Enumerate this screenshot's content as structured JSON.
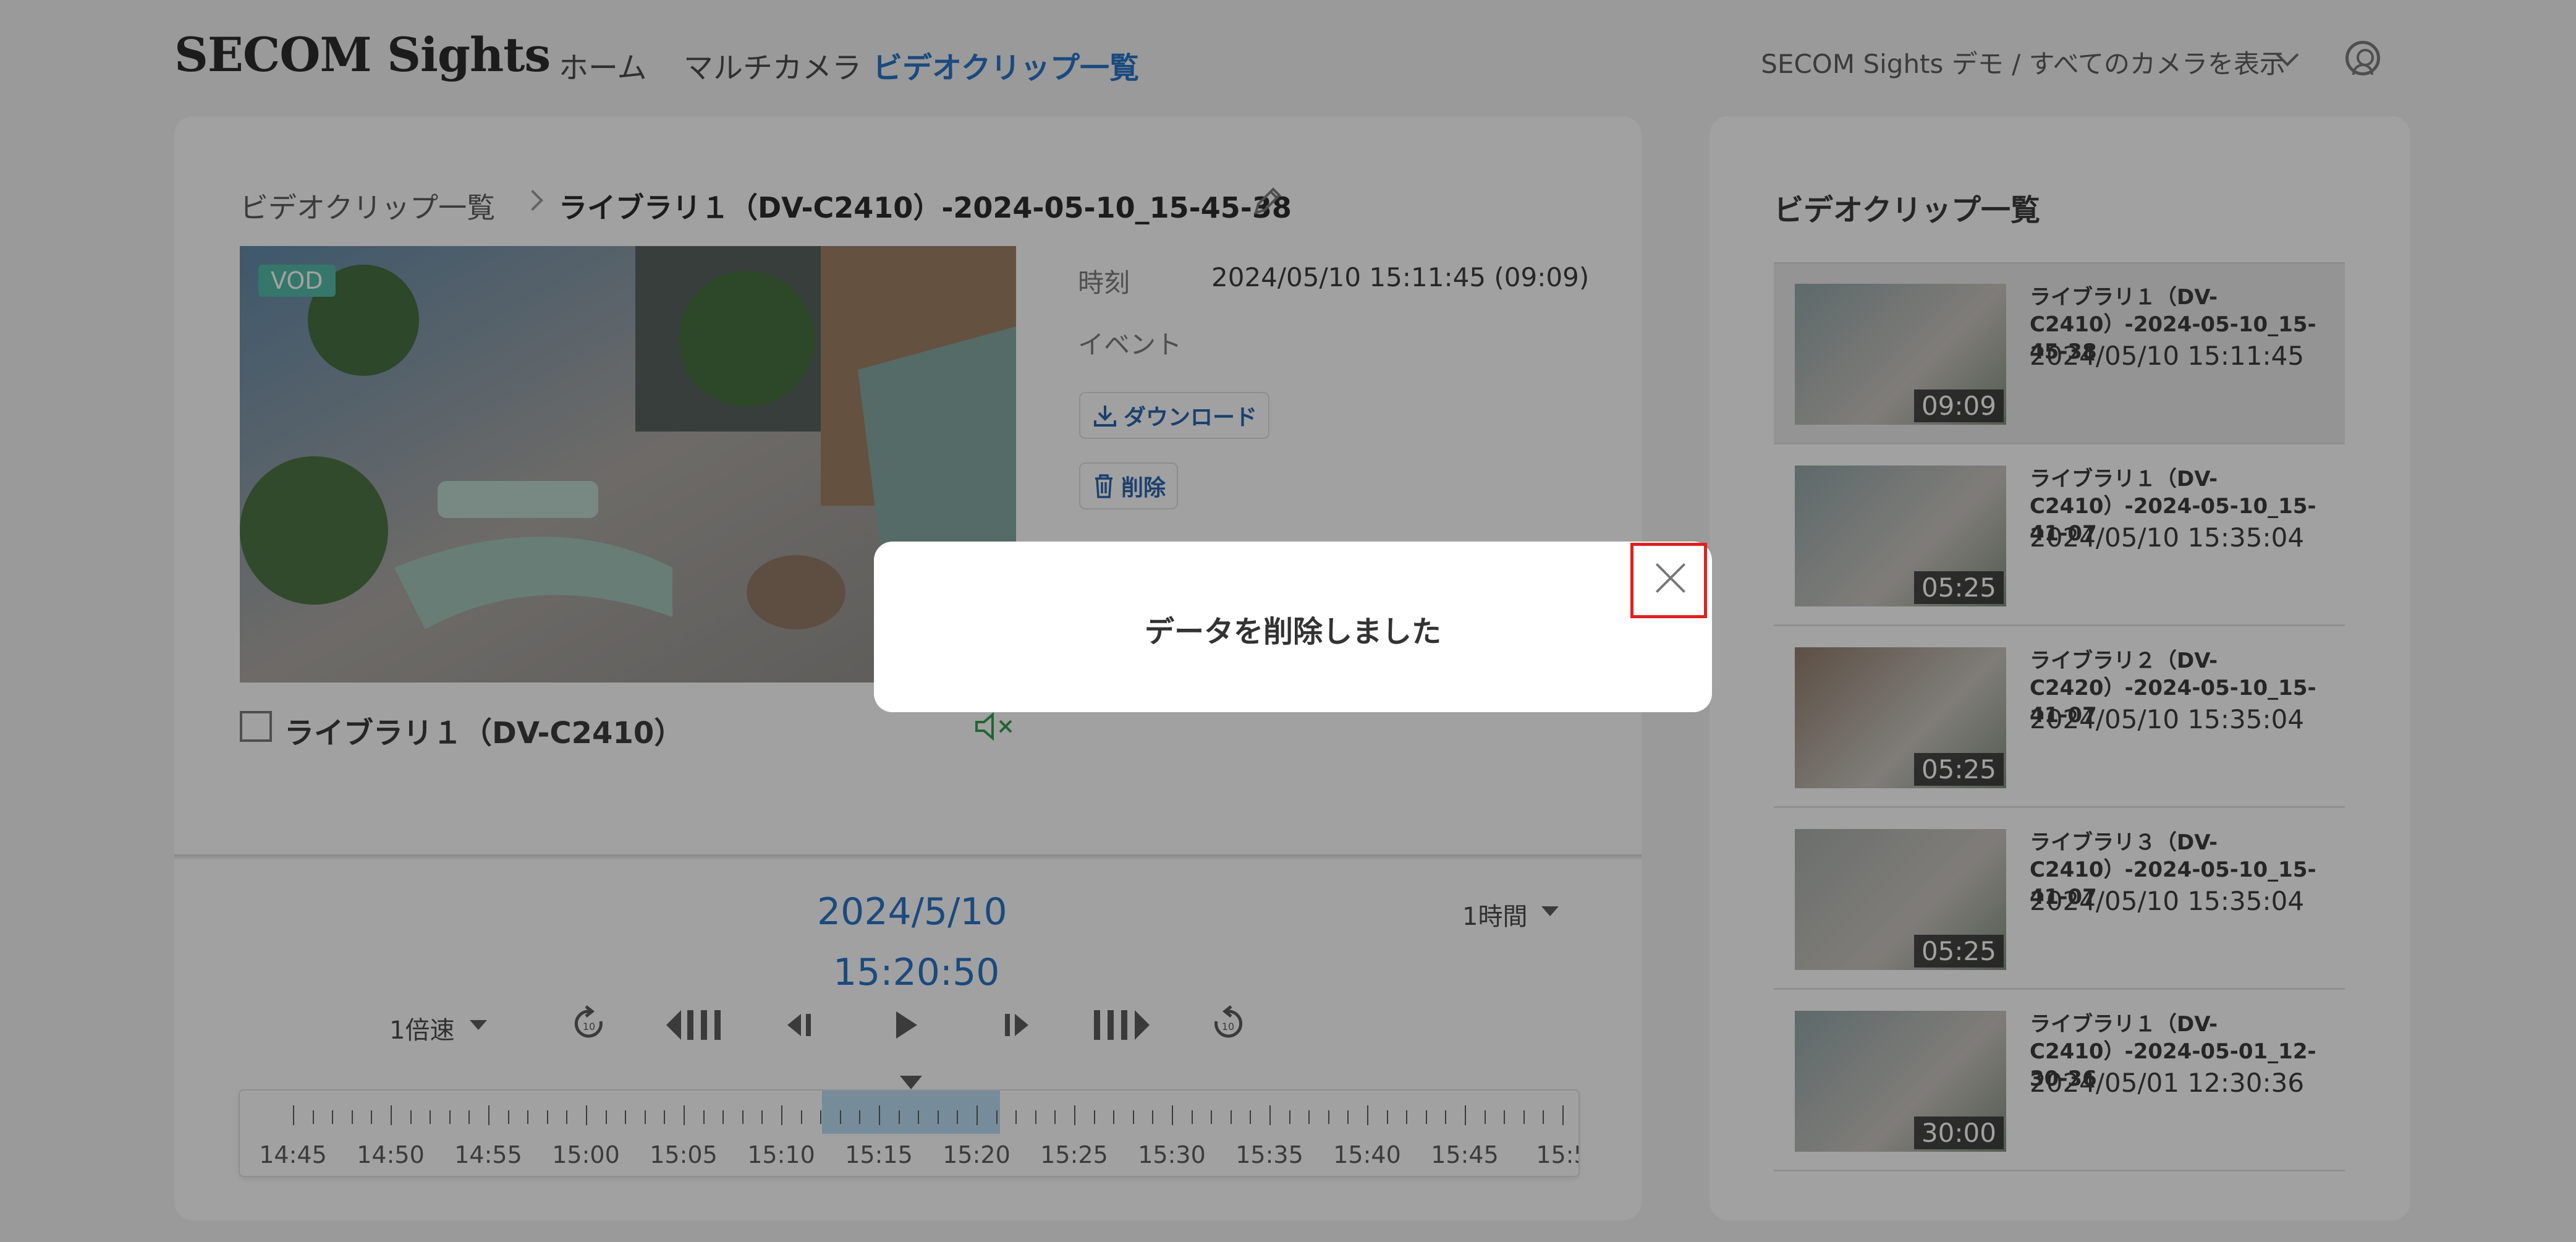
{
  "header": {
    "logo": "SECOM Sights",
    "nav": [
      "ホーム",
      "マルチカメラ",
      "ビデオクリップ一覧"
    ],
    "account": "SECOM Sights デモ / すべてのカメラを表示"
  },
  "detail": {
    "breadcrumb_root": "ビデオクリップ一覧",
    "breadcrumb_current": "ライブラリ１（DV-C2410）-2024-05-10_15-45-38",
    "vod_badge": "VOD",
    "camera_name": "ライブラリ１（DV-C2410）",
    "time_label": "時刻",
    "time_value": "2024/05/10 15:11:45 (09:09)",
    "event_label": "イベント",
    "download_label": "ダウンロード",
    "delete_label": "削除"
  },
  "playback": {
    "date": "2024/5/10",
    "time": "15:20:50",
    "range": "1時間",
    "speed": "1倍速",
    "timeline_labels": [
      "14:45",
      "14:50",
      "14:55",
      "15:00",
      "15:05",
      "15:10",
      "15:15",
      "15:20",
      "15:25",
      "15:30",
      "15:35",
      "15:40",
      "15:45",
      "15:5"
    ]
  },
  "clip_list": {
    "title": "ビデオクリップ一覧",
    "items": [
      {
        "name": "ライブラリ１（DV-C2410）-2024-05-10_15-45-38",
        "stamp": "2024/05/10  15:11:45",
        "duration": "09:09"
      },
      {
        "name": "ライブラリ１（DV-C2410）-2024-05-10_15-41-07",
        "stamp": "2024/05/10  15:35:04",
        "duration": "05:25"
      },
      {
        "name": "ライブラリ２（DV-C2420）-2024-05-10_15-41-07",
        "stamp": "2024/05/10  15:35:04",
        "duration": "05:25"
      },
      {
        "name": "ライブラリ３（DV-C2410）-2024-05-10_15-41-07",
        "stamp": "2024/05/10  15:35:04",
        "duration": "05:25"
      },
      {
        "name": "ライブラリ１（DV-C2410）-2024-05-01_12-30-36",
        "stamp": "2024/05/01  12:30:36",
        "duration": "30:00"
      }
    ]
  },
  "modal": {
    "message": "データを削除しました"
  }
}
